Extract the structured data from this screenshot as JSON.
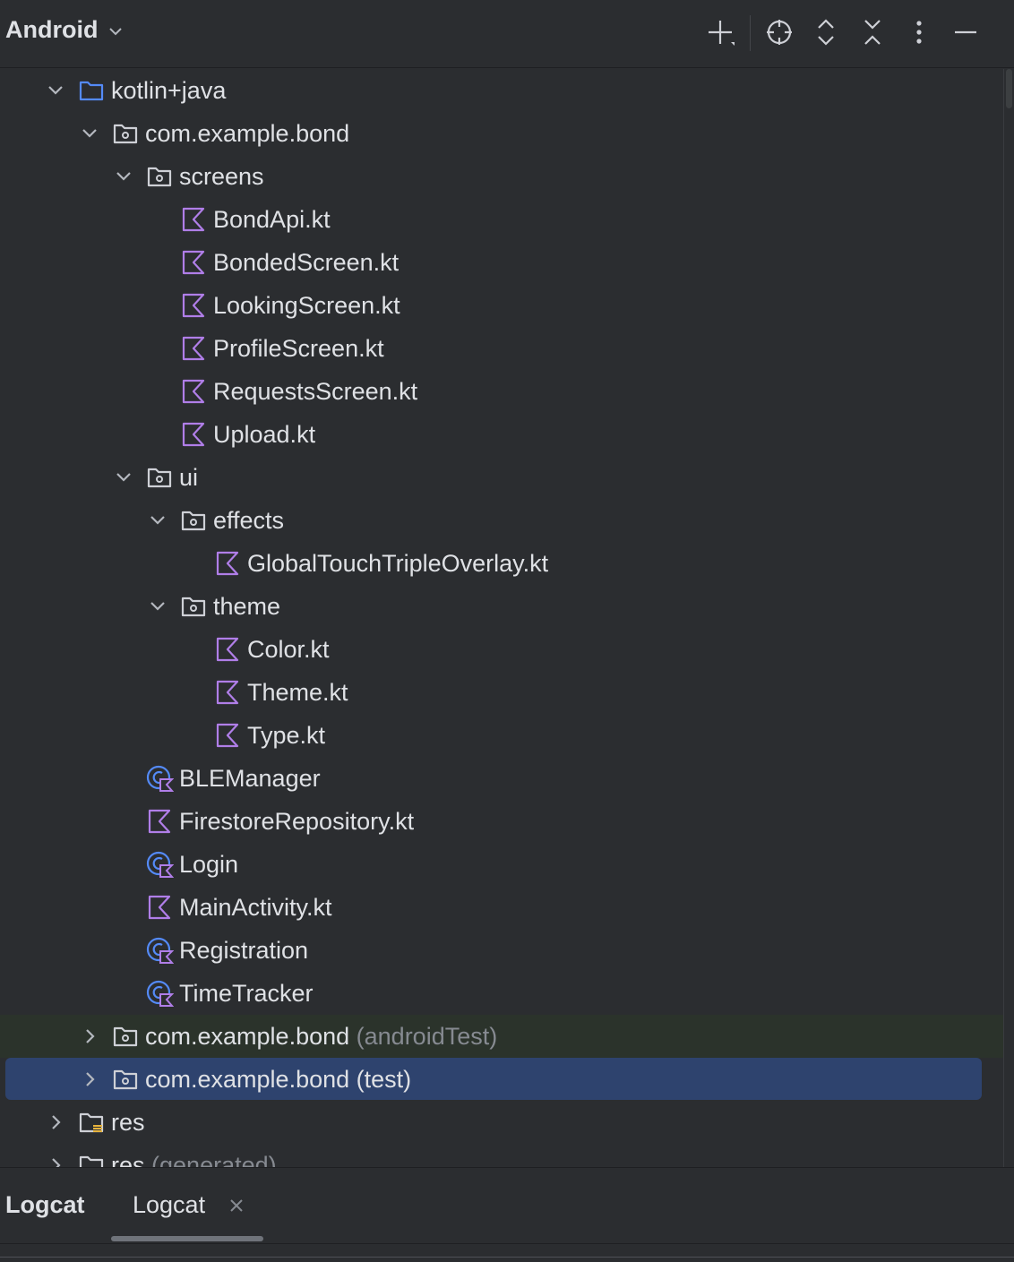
{
  "toolbar": {
    "title": "Android",
    "buttons": [
      "add-icon",
      "locate-icon",
      "expand-all-icon",
      "collapse-all-icon",
      "more-icon",
      "minimize-icon"
    ]
  },
  "colors": {
    "background": "#2b2d30",
    "selection": "#2e436e",
    "test_root_highlight": "#2b332b",
    "kotlin_icon": "#b07ee8",
    "folder_icon": "#548af7",
    "text": "#dfe1e5",
    "muted_text": "#868a91"
  },
  "tree": {
    "rows": [
      {
        "label": "kotlin+java",
        "suffix": "",
        "icon": "source-folder-icon",
        "expanded": true
      },
      {
        "label": "com.example.bond",
        "suffix": "",
        "icon": "package-icon",
        "expanded": true
      },
      {
        "label": "screens",
        "suffix": "",
        "icon": "package-icon",
        "expanded": true
      },
      {
        "label": "BondApi.kt",
        "suffix": "",
        "icon": "kotlin-file-icon"
      },
      {
        "label": "BondedScreen.kt",
        "suffix": "",
        "icon": "kotlin-file-icon"
      },
      {
        "label": "LookingScreen.kt",
        "suffix": "",
        "icon": "kotlin-file-icon"
      },
      {
        "label": "ProfileScreen.kt",
        "suffix": "",
        "icon": "kotlin-file-icon"
      },
      {
        "label": "RequestsScreen.kt",
        "suffix": "",
        "icon": "kotlin-file-icon"
      },
      {
        "label": "Upload.kt",
        "suffix": "",
        "icon": "kotlin-file-icon"
      },
      {
        "label": "ui",
        "suffix": "",
        "icon": "package-icon",
        "expanded": true
      },
      {
        "label": "effects",
        "suffix": "",
        "icon": "package-icon",
        "expanded": true
      },
      {
        "label": "GlobalTouchTripleOverlay.kt",
        "suffix": "",
        "icon": "kotlin-file-icon"
      },
      {
        "label": "theme",
        "suffix": "",
        "icon": "package-icon",
        "expanded": true
      },
      {
        "label": "Color.kt",
        "suffix": "",
        "icon": "kotlin-file-icon"
      },
      {
        "label": "Theme.kt",
        "suffix": "",
        "icon": "kotlin-file-icon"
      },
      {
        "label": "Type.kt",
        "suffix": "",
        "icon": "kotlin-file-icon"
      },
      {
        "label": "BLEManager",
        "suffix": "",
        "icon": "kotlin-class-icon"
      },
      {
        "label": "FirestoreRepository.kt",
        "suffix": "",
        "icon": "kotlin-file-icon"
      },
      {
        "label": "Login",
        "suffix": "",
        "icon": "kotlin-class-icon"
      },
      {
        "label": "MainActivity.kt",
        "suffix": "",
        "icon": "kotlin-file-icon"
      },
      {
        "label": "Registration",
        "suffix": "",
        "icon": "kotlin-class-icon"
      },
      {
        "label": "TimeTracker",
        "suffix": "",
        "icon": "kotlin-class-icon"
      },
      {
        "label": "com.example.bond",
        "suffix": "(androidTest)",
        "icon": "package-icon",
        "expanded": false
      },
      {
        "label": "com.example.bond (test)",
        "suffix": "",
        "icon": "package-icon",
        "expanded": false,
        "selected": true
      },
      {
        "label": "res",
        "suffix": "",
        "icon": "resource-folder-icon",
        "expanded": false
      },
      {
        "label": "res",
        "suffix": "(generated)",
        "icon": "resource-folder-icon",
        "expanded": false
      }
    ]
  },
  "bottom_panel": {
    "title": "Logcat",
    "tabs": [
      {
        "label": "Logcat"
      }
    ]
  }
}
